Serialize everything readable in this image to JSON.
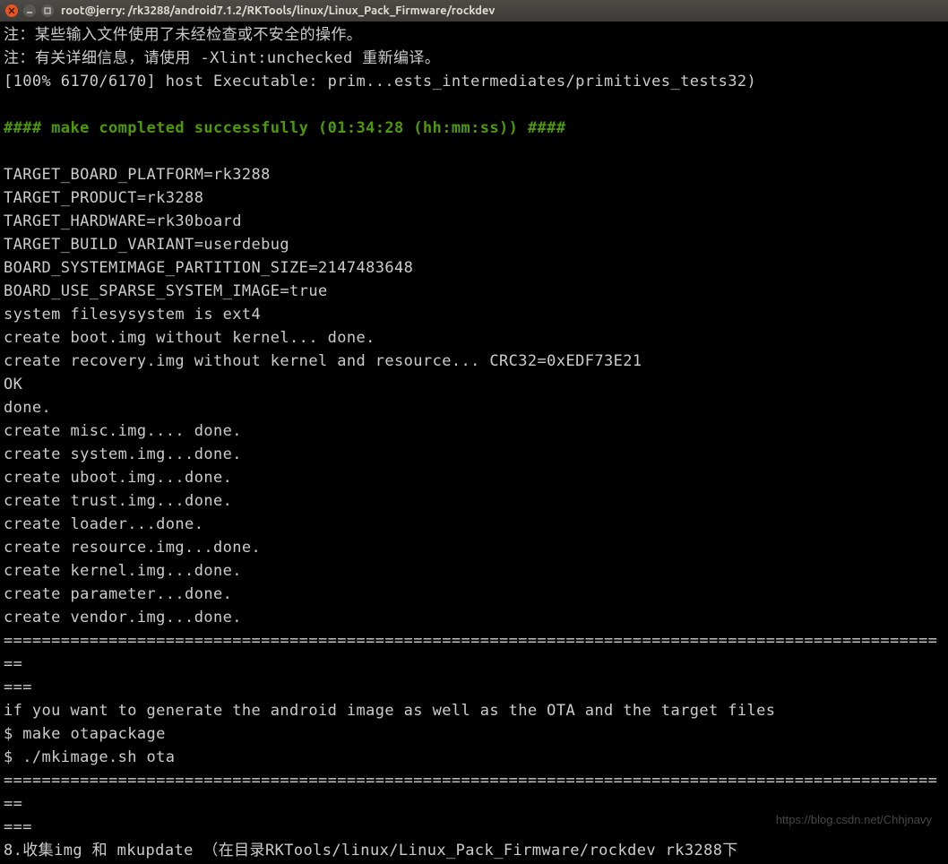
{
  "window": {
    "title": "root@jerry: /rk3288/android7.1.2/RKTools/linux/Linux_Pack_Firmware/rockdev"
  },
  "terminal": {
    "lines": [
      {
        "text": "注：某些输入文件使用了未经检查或不安全的操作。",
        "cls": ""
      },
      {
        "text": "注：有关详细信息，请使用 -Xlint:unchecked 重新编译。",
        "cls": ""
      },
      {
        "text": "[100% 6170/6170] host Executable: prim...ests_intermediates/primitives_tests32)",
        "cls": ""
      },
      {
        "text": "",
        "cls": ""
      },
      {
        "text": "#### make completed successfully (01:34:28 (hh:mm:ss)) ####",
        "cls": "green"
      },
      {
        "text": "",
        "cls": ""
      },
      {
        "text": "TARGET_BOARD_PLATFORM=rk3288",
        "cls": ""
      },
      {
        "text": "TARGET_PRODUCT=rk3288",
        "cls": ""
      },
      {
        "text": "TARGET_HARDWARE=rk30board",
        "cls": ""
      },
      {
        "text": "TARGET_BUILD_VARIANT=userdebug",
        "cls": ""
      },
      {
        "text": "BOARD_SYSTEMIMAGE_PARTITION_SIZE=2147483648",
        "cls": ""
      },
      {
        "text": "BOARD_USE_SPARSE_SYSTEM_IMAGE=true",
        "cls": ""
      },
      {
        "text": "system filesysystem is ext4",
        "cls": ""
      },
      {
        "text": "create boot.img without kernel... done.",
        "cls": ""
      },
      {
        "text": "create recovery.img without kernel and resource... CRC32=0xEDF73E21",
        "cls": ""
      },
      {
        "text": "OK",
        "cls": ""
      },
      {
        "text": "done.",
        "cls": ""
      },
      {
        "text": "create misc.img.... done.",
        "cls": ""
      },
      {
        "text": "create system.img...done.",
        "cls": ""
      },
      {
        "text": "create uboot.img...done.",
        "cls": ""
      },
      {
        "text": "create trust.img...done.",
        "cls": ""
      },
      {
        "text": "create loader...done.",
        "cls": ""
      },
      {
        "text": "create resource.img...done.",
        "cls": ""
      },
      {
        "text": "create kernel.img...done.",
        "cls": ""
      },
      {
        "text": "create parameter...done.",
        "cls": ""
      },
      {
        "text": "create vendor.img...done.",
        "cls": ""
      },
      {
        "text": "====================================================================================================",
        "cls": ""
      },
      {
        "text": "===",
        "cls": ""
      },
      {
        "text": "if you want to generate the android image as well as the OTA and the target files",
        "cls": ""
      },
      {
        "text": "$ make otapackage",
        "cls": ""
      },
      {
        "text": "$ ./mkimage.sh ota",
        "cls": ""
      },
      {
        "text": "====================================================================================================",
        "cls": ""
      },
      {
        "text": "===",
        "cls": ""
      },
      {
        "text": "8.收集img 和 mkupdate （在目录RKTools/linux/Linux_Pack_Firmware/rockdev rk3288下",
        "cls": ""
      }
    ]
  },
  "watermark": "https://blog.csdn.net/Chhjnavy"
}
